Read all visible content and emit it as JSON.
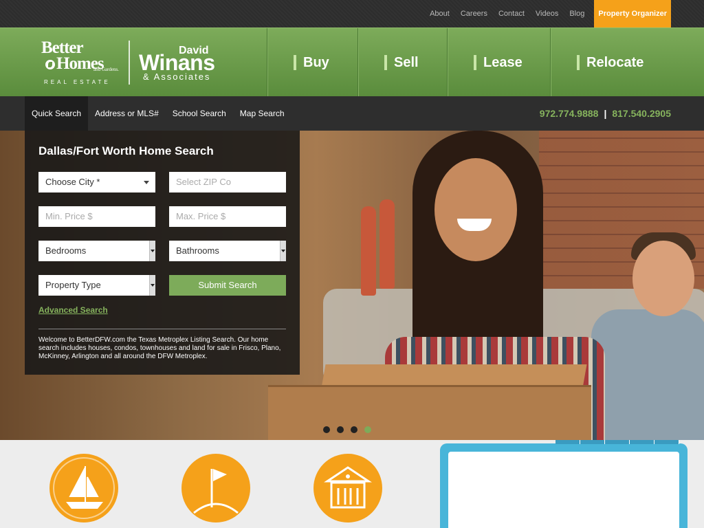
{
  "topbar": {
    "links": [
      "About",
      "Careers",
      "Contact",
      "Videos",
      "Blog"
    ],
    "organizer": "Property Organizer"
  },
  "logo": {
    "line1": "Better",
    "line2": "Homes",
    "gardens": "and Gardens.",
    "real_estate": "REAL ESTATE",
    "david": "David",
    "winans": "Winans",
    "associates": "& Associates"
  },
  "mainnav": [
    "Buy",
    "Sell",
    "Lease",
    "Relocate"
  ],
  "subnav": {
    "tabs": [
      "Quick Search",
      "Address or MLS#",
      "School Search",
      "Map Search"
    ],
    "phone1": "972.774.9888",
    "separator": "|",
    "phone2": "817.540.2905"
  },
  "search": {
    "title": "Dallas/Fort Worth Home Search",
    "city": "Choose City *",
    "zip_placeholder": "Select ZIP Co",
    "min_price": "Min. Price $",
    "max_price": "Max. Price $",
    "bedrooms": "Bedrooms",
    "bathrooms": "Bathrooms",
    "property_type": "Property Type",
    "submit": "Submit Search",
    "advanced": "Advanced Search",
    "description": "Welcome to BetterDFW.com the Texas Metroplex Listing Search. Our home search includes houses, condos, townhouses and land for sale in Frisco, Plano, McKinney, Arlington and all around the DFW Metroplex."
  },
  "carousel": {
    "slides": 4,
    "active": 4
  },
  "colors": {
    "green": "#7dab5a",
    "orange": "#f5a11a",
    "blue": "#48b5d9",
    "dark": "#2e2e2e"
  },
  "icons": [
    "sailboat-icon",
    "flag-icon",
    "house-icon"
  ]
}
